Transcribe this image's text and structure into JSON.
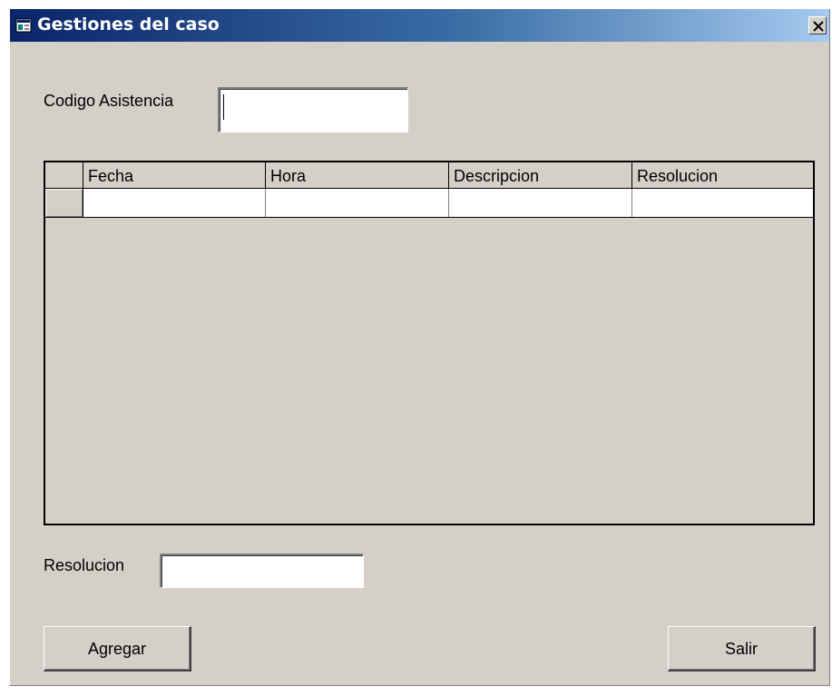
{
  "window": {
    "title": "Gestiones del caso",
    "title_icon": "app-window-icon",
    "close_icon": "close-icon"
  },
  "form": {
    "codigo_label": "Codigo Asistencia",
    "codigo_value": "",
    "resolucion_label": "Resolucion",
    "resolucion_value": ""
  },
  "grid": {
    "columns": [
      "Fecha",
      "Hora",
      "Descripcion",
      "Resolucion"
    ],
    "rows": [
      [
        "",
        "",
        "",
        ""
      ]
    ]
  },
  "buttons": {
    "add_label": "Agregar",
    "exit_label": "Salir"
  },
  "colors": {
    "title_gradient_start": "#0a246a",
    "title_gradient_end": "#a6caf0",
    "face": "#d4d0c8"
  }
}
